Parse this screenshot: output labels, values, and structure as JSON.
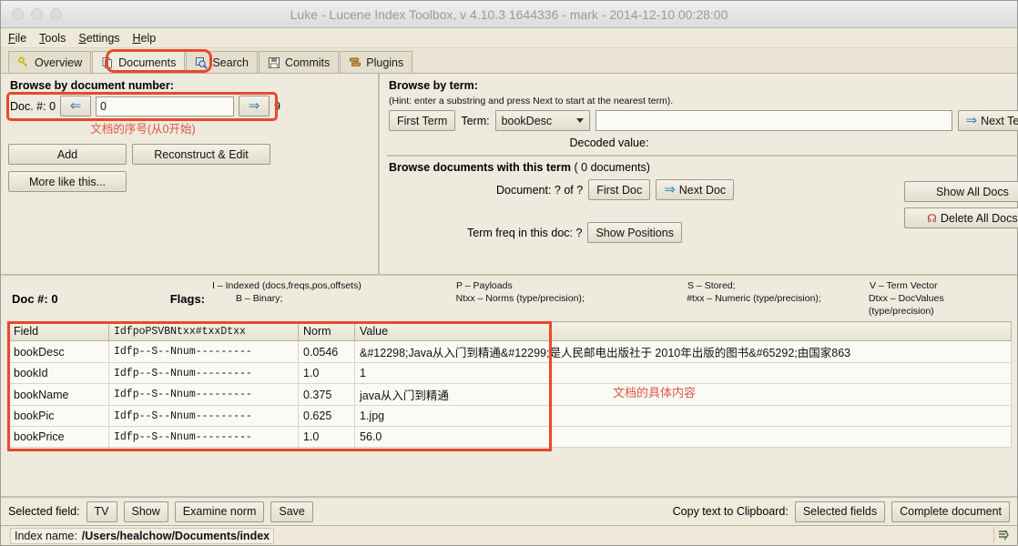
{
  "window": {
    "title": "Luke - Lucene Index Toolbox, v 4.10.3 1644336 - mark - 2014-12-10 00:28:00"
  },
  "menubar": [
    {
      "label": "File",
      "mnemonic": "F"
    },
    {
      "label": "Tools",
      "mnemonic": "T"
    },
    {
      "label": "Settings",
      "mnemonic": "S"
    },
    {
      "label": "Help",
      "mnemonic": "H"
    }
  ],
  "tabs": [
    {
      "label": "Overview",
      "icon": "key-icon",
      "active": false
    },
    {
      "label": "Documents",
      "icon": "documents-icon",
      "active": true
    },
    {
      "label": "Search",
      "icon": "magnifier-icon",
      "active": false
    },
    {
      "label": "Commits",
      "icon": "floppy-icon",
      "active": false
    },
    {
      "label": "Plugins",
      "icon": "plugins-icon",
      "active": false
    }
  ],
  "browse_by_doc": {
    "title": "Browse by document number:",
    "doc_label": "Doc. #: 0",
    "prev_icon": "left-arrow-icon",
    "next_icon": "right-arrow-icon",
    "doc_input_value": "0",
    "max_doc": "9",
    "annotation": "文档的序号(从0开始)",
    "add_label": "Add",
    "reconstruct_label": "Reconstruct & Edit",
    "more_like_this_label": "More like this..."
  },
  "browse_by_term": {
    "title": "Browse by term:",
    "hint": "(Hint: enter a substring and press Next to start at the nearest term).",
    "first_term_label": "First Term",
    "term_label": "Term:",
    "field_selected": "bookDesc",
    "term_input_value": "",
    "next_term_label": "Next Term",
    "next_term_icon": "right-arrow-icon",
    "decoded_value_label": "Decoded value:"
  },
  "browse_docs": {
    "heading": "Browse documents with this term",
    "count": "( 0  documents)",
    "document_label": "Document: ? of ?",
    "first_doc_label": "First Doc",
    "next_doc_label": "Next Doc",
    "next_doc_icon": "right-arrow-icon",
    "term_freq_label": "Term freq in this doc: ?",
    "show_positions_label": "Show Positions",
    "show_all_docs_label": "Show All Docs",
    "delete_all_docs_label": "Delete All Docs",
    "delete_icon": "trash-icon"
  },
  "flags": {
    "doc_number": "Doc #: 0",
    "flags_label": "Flags:",
    "row1": [
      "I – Indexed (docs,freqs,pos,offsets)",
      "P – Payloads",
      "S – Stored;",
      "V – Term Vector"
    ],
    "row2": [
      "B – Binary;",
      "Ntxx – Norms (type/precision);",
      "#txx – Numeric (type/precision);",
      "Dtxx – DocValues (type/precision)"
    ]
  },
  "table": {
    "columns": [
      "Field",
      "IdfpoPSVBNtxx#txxDtxx",
      "Norm",
      "Value"
    ],
    "rows": [
      {
        "field": "bookDesc",
        "flags": "Idfp--S--Nnum---------",
        "norm": "0.0546",
        "value": "&#12298;Java从入门到精通&#12299;是人民邮电出版社于 2010年出版的图书&#65292;由国家863"
      },
      {
        "field": "bookId",
        "flags": "Idfp--S--Nnum---------",
        "norm": "1.0",
        "value": "1"
      },
      {
        "field": "bookName",
        "flags": "Idfp--S--Nnum---------",
        "norm": "0.375",
        "value": "java从入门到精通"
      },
      {
        "field": "bookPic",
        "flags": "Idfp--S--Nnum---------",
        "norm": "0.625",
        "value": "1.jpg"
      },
      {
        "field": "bookPrice",
        "flags": "Idfp--S--Nnum---------",
        "norm": "1.0",
        "value": "56.0"
      }
    ],
    "annotation": "文档的具体内容"
  },
  "bottom": {
    "selected_field_label": "Selected field:",
    "tv_label": "TV",
    "show_label": "Show",
    "examine_norm_label": "Examine norm",
    "save_label": "Save",
    "copy_label": "Copy text to Clipboard:",
    "selected_fields_label": "Selected fields",
    "complete_document_label": "Complete document"
  },
  "status": {
    "index_name_label": "Index name:",
    "index_path": "/Users/healchow/Documents/index",
    "corner_icon": "resize-icon"
  },
  "colors": {
    "highlight": "#e8492c",
    "annotation": "#e0553f",
    "panel": "#efeade",
    "chrome": "#eee9d9",
    "arrow_blue": "#2f7fb5"
  }
}
